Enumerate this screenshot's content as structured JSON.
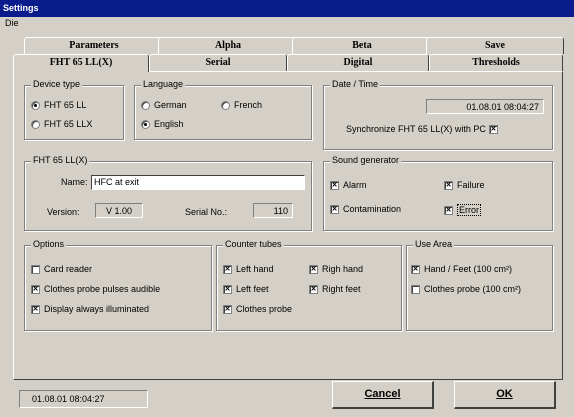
{
  "window": {
    "title": "Settings"
  },
  "menu": {
    "file": "Die"
  },
  "tabs": {
    "back": [
      "Parameters",
      "Alpha",
      "Beta",
      "Save"
    ],
    "front": [
      "FHT 65 LL(X)",
      "Serial",
      "Digital",
      "Thresholds"
    ]
  },
  "device_type": {
    "label": "Device type",
    "options": [
      "FHT 65 LL",
      "FHT 65 LLX"
    ],
    "selected": "FHT 65 LL"
  },
  "language": {
    "label": "Language",
    "options": [
      "German",
      "French",
      "English"
    ],
    "selected": "English"
  },
  "date_time": {
    "label": "Date / Time",
    "value": "01.08.01  08:04:27",
    "sync_label": "Synchronize FHT 65 LL(X) with PC",
    "sync_checked": true
  },
  "device": {
    "label": "FHT 65 LL(X)",
    "name_label": "Name:",
    "name_value": "HFC at exit",
    "version_label": "Version:",
    "version_value": "V 1.00",
    "serial_label": "Serial No.:",
    "serial_value": "110"
  },
  "sound": {
    "label": "Sound generator",
    "items": [
      {
        "label": "Alarm",
        "checked": true
      },
      {
        "label": "Failure",
        "checked": true
      },
      {
        "label": "Contamination",
        "checked": true
      },
      {
        "label": "Error",
        "checked": true
      }
    ]
  },
  "options": {
    "label": "Options",
    "items": [
      {
        "label": "Card reader",
        "checked": false
      },
      {
        "label": "Clothes probe pulses audible",
        "checked": true
      },
      {
        "label": "Display always illuminated",
        "checked": true
      }
    ]
  },
  "counter_tubes": {
    "label": "Counter tubes",
    "items": [
      {
        "label": "Left hand",
        "checked": true
      },
      {
        "label": "Righ hand",
        "checked": true
      },
      {
        "label": "Left feet",
        "checked": true
      },
      {
        "label": "Right feet",
        "checked": true
      },
      {
        "label": "Clothes probe",
        "checked": true
      }
    ]
  },
  "use_area": {
    "label": "Use Area",
    "items": [
      {
        "label": "Hand / Feet (100 cm²)",
        "checked": true
      },
      {
        "label": "Clothes probe (100 cm²)",
        "checked": false
      }
    ]
  },
  "status": {
    "datetime": "01.08.01  08:04:27"
  },
  "buttons": {
    "cancel": "Cancel",
    "ok": "OK"
  }
}
